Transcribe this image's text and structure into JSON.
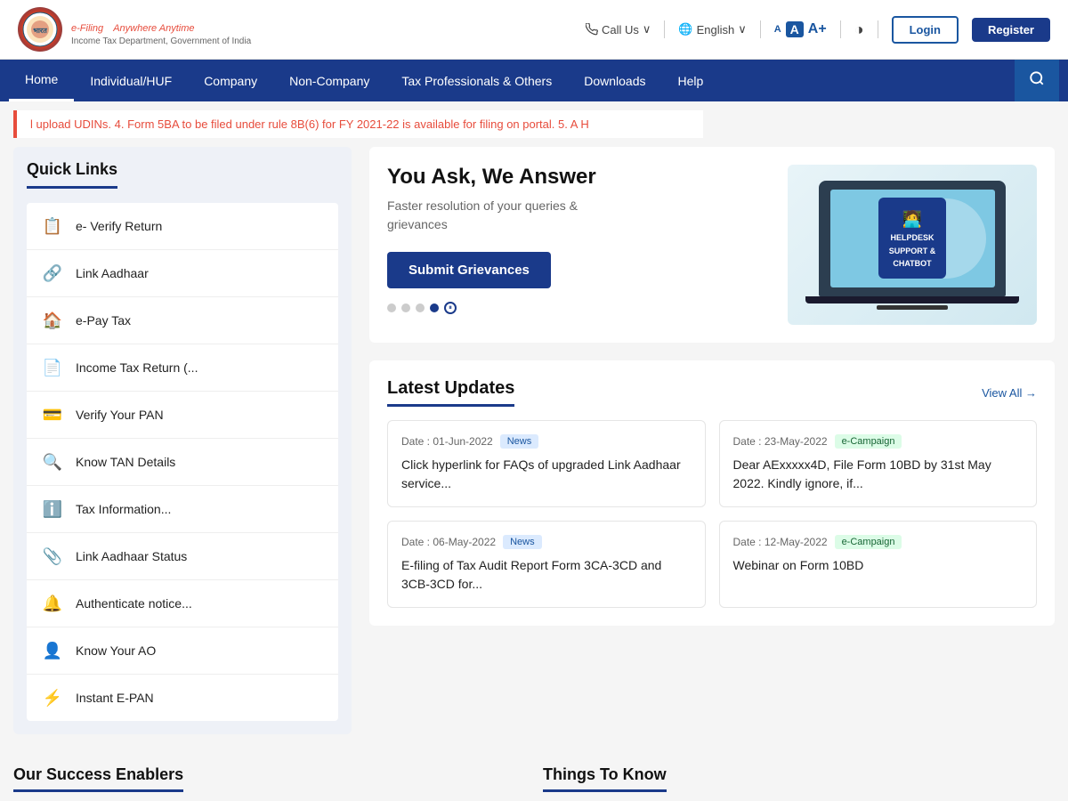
{
  "header": {
    "logo_title": "e-Filing",
    "logo_tagline": "Anywhere Anytime",
    "logo_subtitle": "Income Tax Department, Government of India",
    "call_us": "Call Us",
    "language": "English",
    "font_small": "A",
    "font_medium": "A",
    "font_large": "A+",
    "login_label": "Login",
    "register_label": "Register"
  },
  "nav": {
    "items": [
      {
        "label": "Home",
        "active": true
      },
      {
        "label": "Individual/HUF",
        "active": false
      },
      {
        "label": "Company",
        "active": false
      },
      {
        "label": "Non-Company",
        "active": false
      },
      {
        "label": "Tax Professionals & Others",
        "active": false
      },
      {
        "label": "Downloads",
        "active": false
      },
      {
        "label": "Help",
        "active": false
      }
    ]
  },
  "ticker": {
    "text": "l upload UDINs. 4. Form 5BA to be filed under rule 8B(6) for FY 2021-22 is available for filing on portal. 5. A H"
  },
  "quick_links": {
    "title": "Quick Links",
    "items": [
      {
        "icon": "📋",
        "label": "e- Verify Return"
      },
      {
        "icon": "🔗",
        "label": "Link Aadhaar"
      },
      {
        "icon": "🏠",
        "label": "e-Pay Tax"
      },
      {
        "icon": "📄",
        "label": "Income Tax Return (..."
      },
      {
        "icon": "💳",
        "label": "Verify Your PAN"
      },
      {
        "icon": "🔍",
        "label": "Know TAN Details"
      },
      {
        "icon": "ℹ️",
        "label": "Tax Information..."
      },
      {
        "icon": "📎",
        "label": "Link Aadhaar Status"
      },
      {
        "icon": "🔔",
        "label": "Authenticate notice..."
      },
      {
        "icon": "👤",
        "label": "Know Your AO"
      },
      {
        "icon": "⚡",
        "label": "Instant E-PAN"
      }
    ]
  },
  "hero": {
    "title": "You Ask, We Answer",
    "subtitle": "Faster resolution of your queries &\ngrievances",
    "submit_btn": "Submit Grievances",
    "helpdesk_line1": "HELPDESK",
    "helpdesk_line2": "SUPPORT &",
    "helpdesk_line3": "CHATBOT"
  },
  "latest_updates": {
    "title": "Latest Updates",
    "view_all": "View All →",
    "cards": [
      {
        "date": "Date : 01-Jun-2022",
        "badge": "News",
        "badge_type": "news",
        "text": "Click hyperlink for FAQs of upgraded Link Aadhaar service..."
      },
      {
        "date": "Date : 23-May-2022",
        "badge": "e-Campaign",
        "badge_type": "campaign",
        "text": "Dear AExxxxx4D, File Form 10BD by 31st May 2022. Kindly ignore, if..."
      },
      {
        "date": "Date : 06-May-2022",
        "badge": "News",
        "badge_type": "news",
        "text": "E-filing of Tax Audit Report Form 3CA-3CD and 3CB-3CD for..."
      },
      {
        "date": "Date : 12-May-2022",
        "badge": "e-Campaign",
        "badge_type": "campaign",
        "text": "Webinar on Form 10BD"
      }
    ]
  },
  "bottom": {
    "success_title": "Our Success Enablers",
    "things_title": "Things To Know"
  }
}
